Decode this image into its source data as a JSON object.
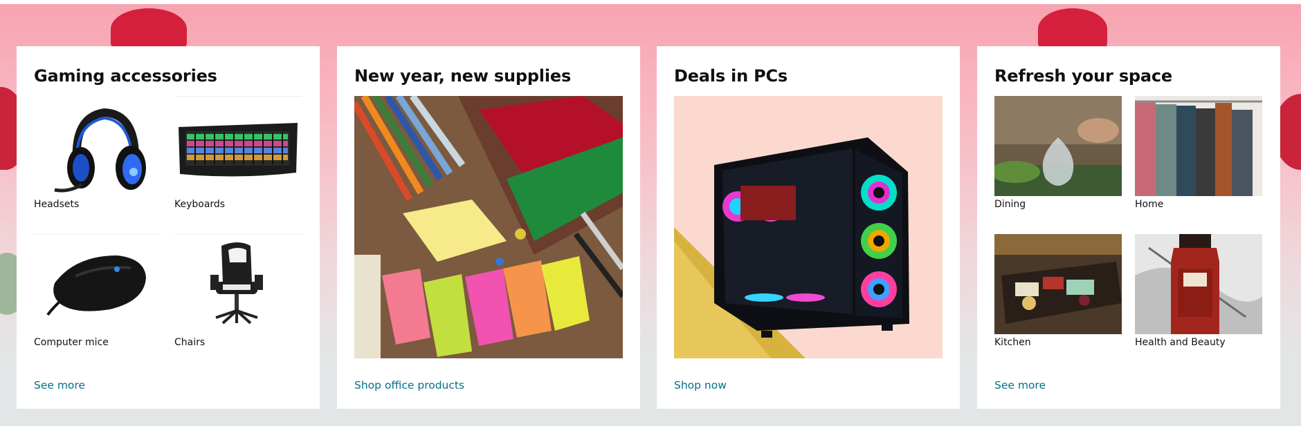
{
  "colors": {
    "background": "#e3e6e6",
    "banner": "#f7a3b0",
    "card": "#ffffff",
    "title": "#0f1111",
    "link": "#007185"
  },
  "cards": [
    {
      "title": "Gaming accessories",
      "tiles": [
        {
          "label": "Headsets",
          "icon": "headset-image"
        },
        {
          "label": "Keyboards",
          "icon": "keyboard-image"
        },
        {
          "label": "Computer mice",
          "icon": "mouse-image"
        },
        {
          "label": "Chairs",
          "icon": "chair-image"
        }
      ],
      "link": "See more"
    },
    {
      "title": "New year, new supplies",
      "image": "office-supplies-image",
      "link": "Shop office products"
    },
    {
      "title": "Deals in PCs",
      "image": "gaming-pc-image",
      "link": "Shop now"
    },
    {
      "title": "Refresh your space",
      "tiles": [
        {
          "label": "Dining",
          "icon": "dining-image"
        },
        {
          "label": "Home",
          "icon": "home-image"
        },
        {
          "label": "Kitchen",
          "icon": "kitchen-image"
        },
        {
          "label": "Health and Beauty",
          "icon": "health-beauty-image"
        }
      ],
      "link": "See more"
    }
  ]
}
